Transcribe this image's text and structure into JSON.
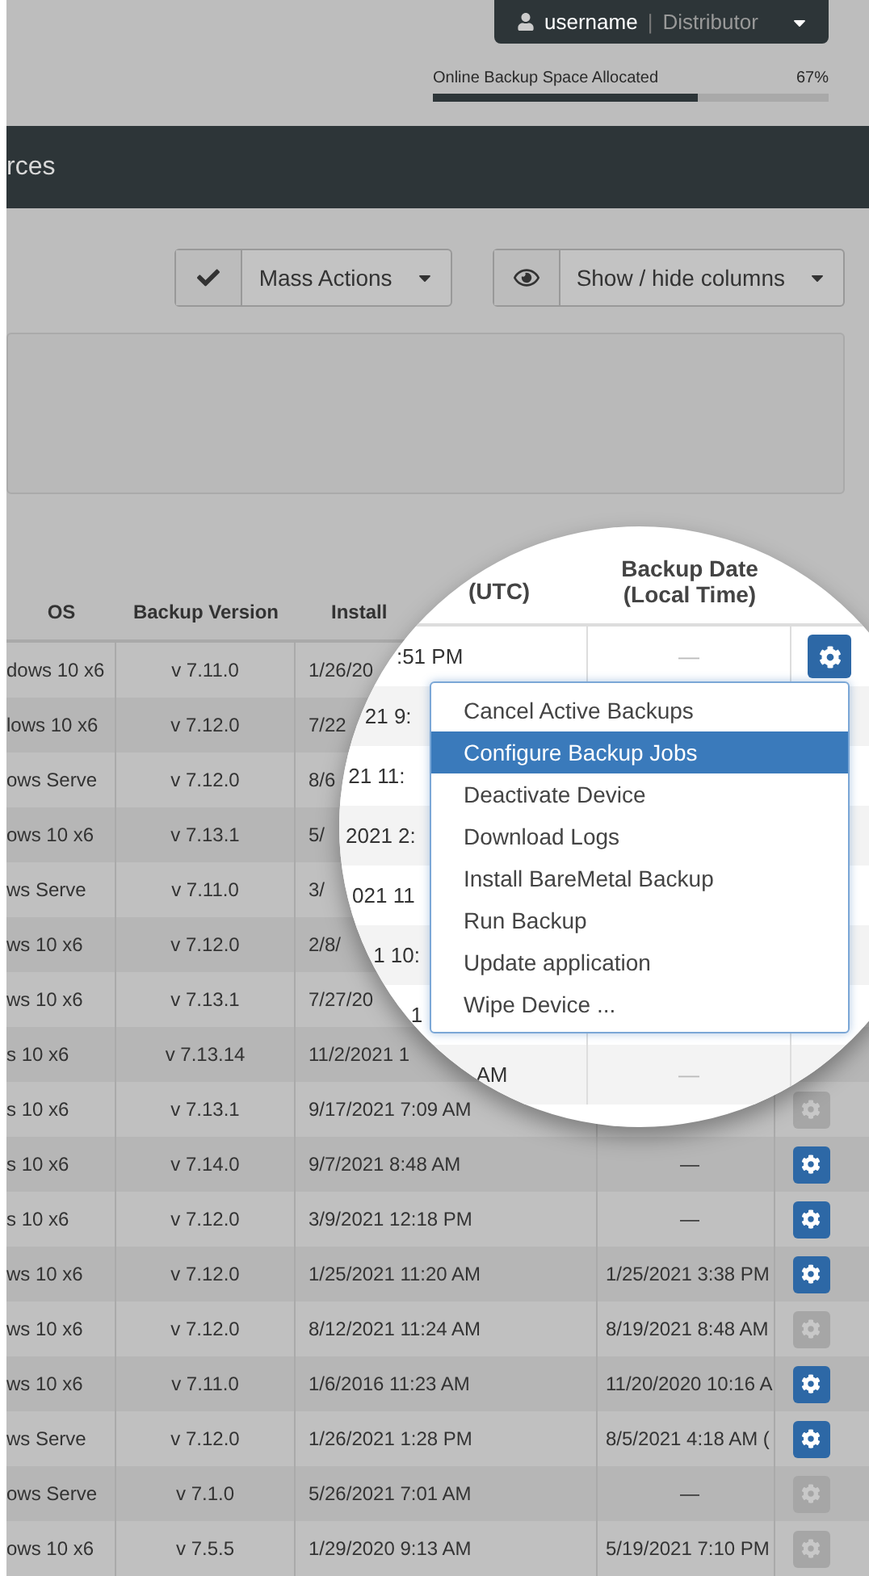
{
  "user_menu": {
    "username": "username",
    "separator": "|",
    "role": "Distributor"
  },
  "storage": {
    "label": "Online Backup Space Allocated",
    "reading": "67%",
    "level": 0.67
  },
  "header": {
    "title": "rces"
  },
  "toolbar": [
    {
      "label": "Mass Actions",
      "kind": "check"
    },
    {
      "label": "Show / hide columns",
      "kind": "eye"
    }
  ],
  "table": {
    "columns": [
      "OS",
      "Backup Version",
      "Install"
    ],
    "rows": [
      {
        "os": "dows 10 x6",
        "version": "v 7.11.0",
        "install": "1/26/20"
      },
      {
        "os": "lows 10 x6",
        "version": "v 7.12.0",
        "install": "7/22"
      },
      {
        "os": "ows Serve",
        "version": "v 7.12.0",
        "install": "8/6"
      },
      {
        "os": "ows 10 x6",
        "version": "v 7.13.1",
        "install": "5/"
      },
      {
        "os": "ws Serve",
        "version": "v 7.11.0",
        "install": "3/"
      },
      {
        "os": "ws 10 x6",
        "version": "v 7.12.0",
        "install": "2/8/"
      },
      {
        "os": "ws 10 x6",
        "version": "v 7.13.1",
        "install": "7/27/20"
      },
      {
        "os": "s 10 x6",
        "version": "v 7.13.14",
        "install": "11/2/2021 1"
      },
      {
        "os": "s 10 x6",
        "version": "v 7.13.1",
        "install": "9/17/2021 7:09 AM",
        "action": {
          "enabled": false
        }
      },
      {
        "os": "s 10 x6",
        "version": "v 7.14.0",
        "install": "9/7/2021 8:48 AM",
        "last_backup": "—",
        "action": {
          "enabled": true
        }
      },
      {
        "os": "s 10 x6",
        "version": "v 7.12.0",
        "install": "3/9/2021 12:18 PM",
        "last_backup": "—",
        "action": {
          "enabled": true
        }
      },
      {
        "os": "ws 10 x6",
        "version": "v 7.12.0",
        "install": "1/25/2021 11:20 AM",
        "last_backup": "1/25/2021 3:38 PM",
        "action": {
          "enabled": true
        }
      },
      {
        "os": "ws 10 x6",
        "version": "v 7.12.0",
        "install": "8/12/2021 11:24 AM",
        "last_backup": "8/19/2021 8:48 AM",
        "action": {
          "enabled": false
        }
      },
      {
        "os": "ws 10 x6",
        "version": "v 7.11.0",
        "install": "1/6/2016 11:23 AM",
        "last_backup": "11/20/2020 10:16 A",
        "action": {
          "enabled": true
        }
      },
      {
        "os": "ws Serve",
        "version": "v 7.12.0",
        "install": "1/26/2021 1:28 PM",
        "last_backup": "8/5/2021 4:18 AM (",
        "action": {
          "enabled": true
        }
      },
      {
        "os": "ows Serve",
        "version": "v 7.1.0",
        "install": "5/26/2021 7:01 AM",
        "last_backup": "—",
        "action": {
          "enabled": false
        }
      },
      {
        "os": "ows 10 x6",
        "version": "v 7.5.5",
        "install": "1/29/2020 9:13 AM",
        "last_backup": "5/19/2021 7:10 PM",
        "action": {
          "enabled": false
        }
      }
    ]
  },
  "lens": {
    "install_header": "(UTC)",
    "last_backup_header": "Backup Date (Local Time)",
    "rows": [
      {
        "install": ":51 PM",
        "last_backup": "—",
        "action": {
          "enabled": true
        }
      },
      {
        "install": "21 9:"
      },
      {
        "install": "21 11:"
      },
      {
        "install": "2021 2:"
      },
      {
        "install": "021 11"
      },
      {
        "install": "1 10:"
      },
      {
        "install": "1"
      },
      {
        "install": "AM",
        "last_backup": "—"
      }
    ],
    "menu": [
      {
        "label": "Cancel Active Backups",
        "selected": false
      },
      {
        "label": "Configure Backup Jobs",
        "selected": true
      },
      {
        "label": "Deactivate Device",
        "selected": false
      },
      {
        "label": "Download Logs",
        "selected": false
      },
      {
        "label": "Install BareMetal Backup",
        "selected": false
      },
      {
        "label": "Run Backup",
        "selected": false
      },
      {
        "label": "Update application",
        "selected": false
      },
      {
        "label": "Wipe Device ...",
        "selected": false
      }
    ]
  }
}
